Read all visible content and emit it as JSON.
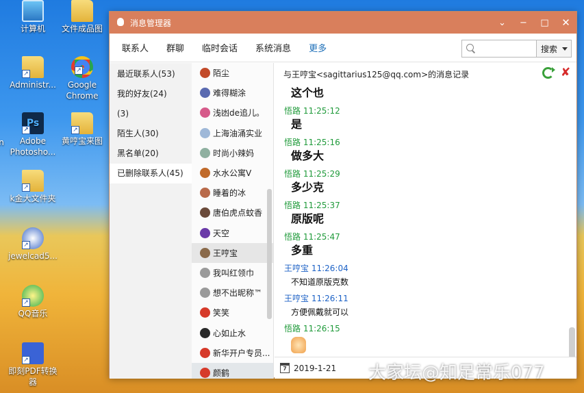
{
  "desktop": {
    "icons": [
      {
        "label": "计算机",
        "kind": "pc"
      },
      {
        "label": "文件成品图",
        "kind": "folder"
      },
      {
        "label": "Administr...",
        "kind": "folder"
      },
      {
        "label": "Google Chrome",
        "kind": "chrome"
      },
      {
        "label": "Adobe Photosho...",
        "kind": "ps"
      },
      {
        "label": "黄哼宝来图",
        "kind": "folder"
      },
      {
        "label": "k金大文件夹",
        "kind": "folder"
      },
      {
        "label": "jewelcad5...",
        "kind": "jc"
      },
      {
        "label": "QQ音乐",
        "kind": "qqm"
      },
      {
        "label": "即刻PDF转换器",
        "kind": "pdf"
      }
    ],
    "left_edge_label": "n"
  },
  "window": {
    "title": "消息管理器",
    "controls": {
      "menu": "⌄",
      "minimize": "−",
      "maximize": "□",
      "close": "✕"
    }
  },
  "toolbar": {
    "tabs": [
      "联系人",
      "群聊",
      "临时会话",
      "系统消息",
      "更多"
    ],
    "active_tab": 4,
    "search": {
      "placeholder": "",
      "value": "",
      "button_label": "搜索"
    }
  },
  "sidebar": {
    "items": [
      "最近联系人(53)",
      "我的好友(24)",
      "(3)",
      "陌生人(30)",
      "黑名单(20)",
      "已删除联系人(45)"
    ],
    "active": 5
  },
  "contacts": {
    "items": [
      {
        "name": "陌尘",
        "color": "#c24a2a"
      },
      {
        "name": "难得糊涂",
        "color": "#5a6ab0"
      },
      {
        "name": "浅凼de追儿。",
        "color": "#d65a8a"
      },
      {
        "name": "上海油涌实业",
        "color": "#9fb8d8"
      },
      {
        "name": "时尚小辣妈",
        "color": "#8fb0a0"
      },
      {
        "name": "水水公寓V",
        "color": "#c06a2a"
      },
      {
        "name": "睡着的冰",
        "color": "#b86a4a"
      },
      {
        "name": "唐伯虎点蚊香",
        "color": "#6a4a3a"
      },
      {
        "name": "天空",
        "color": "#6a3aa8"
      },
      {
        "name": "王哼宝",
        "color": "#8a6a4a"
      },
      {
        "name": "我叫红领巾",
        "color": "#9a9a9a"
      },
      {
        "name": "想不出昵称™",
        "color": "#9a9a9a"
      },
      {
        "name": "笑笑",
        "color": "#d63a2a"
      },
      {
        "name": "心如止水",
        "color": "#2a2a2a"
      },
      {
        "name": "新华开户专员...",
        "color": "#d63a2a"
      },
      {
        "name": "颜鹤",
        "color": "#d63a2a"
      }
    ],
    "selected": 9,
    "hovered": 15
  },
  "messages": {
    "header": "与王哼宝<sagittarius125@qq.com>的消息记录",
    "entries": [
      {
        "type": "text",
        "size": "big",
        "text": "这个也"
      },
      {
        "type": "meta",
        "sender": "悟路",
        "time": "11:25:12",
        "side": "self"
      },
      {
        "type": "text",
        "size": "big",
        "text": "是"
      },
      {
        "type": "meta",
        "sender": "悟路",
        "time": "11:25:16",
        "side": "self"
      },
      {
        "type": "text",
        "size": "big",
        "text": "做多大"
      },
      {
        "type": "meta",
        "sender": "悟路",
        "time": "11:25:29",
        "side": "self"
      },
      {
        "type": "text",
        "size": "big",
        "text": "多少克"
      },
      {
        "type": "meta",
        "sender": "悟路",
        "time": "11:25:37",
        "side": "self"
      },
      {
        "type": "text",
        "size": "big",
        "text": "原版呢"
      },
      {
        "type": "meta",
        "sender": "悟路",
        "time": "11:25:47",
        "side": "self"
      },
      {
        "type": "text",
        "size": "big",
        "text": "多重"
      },
      {
        "type": "meta",
        "sender": "王哼宝",
        "time": "11:26:04",
        "side": "other"
      },
      {
        "type": "text",
        "size": "small",
        "text": "不知道原版克数"
      },
      {
        "type": "meta",
        "sender": "王哼宝",
        "time": "11:26:11",
        "side": "other"
      },
      {
        "type": "text",
        "size": "small",
        "text": "方便佩戴就可以"
      },
      {
        "type": "meta",
        "sender": "悟路",
        "time": "11:26:15",
        "side": "self"
      },
      {
        "type": "emoji",
        "name": "ok-hand-emoji"
      }
    ],
    "colors": {
      "self": "#1f9a3a",
      "other": "#1d62c6"
    }
  },
  "footer": {
    "date": "2019-1-21",
    "calendar_day": "7"
  },
  "watermark": "大家坛@知足常乐077"
}
